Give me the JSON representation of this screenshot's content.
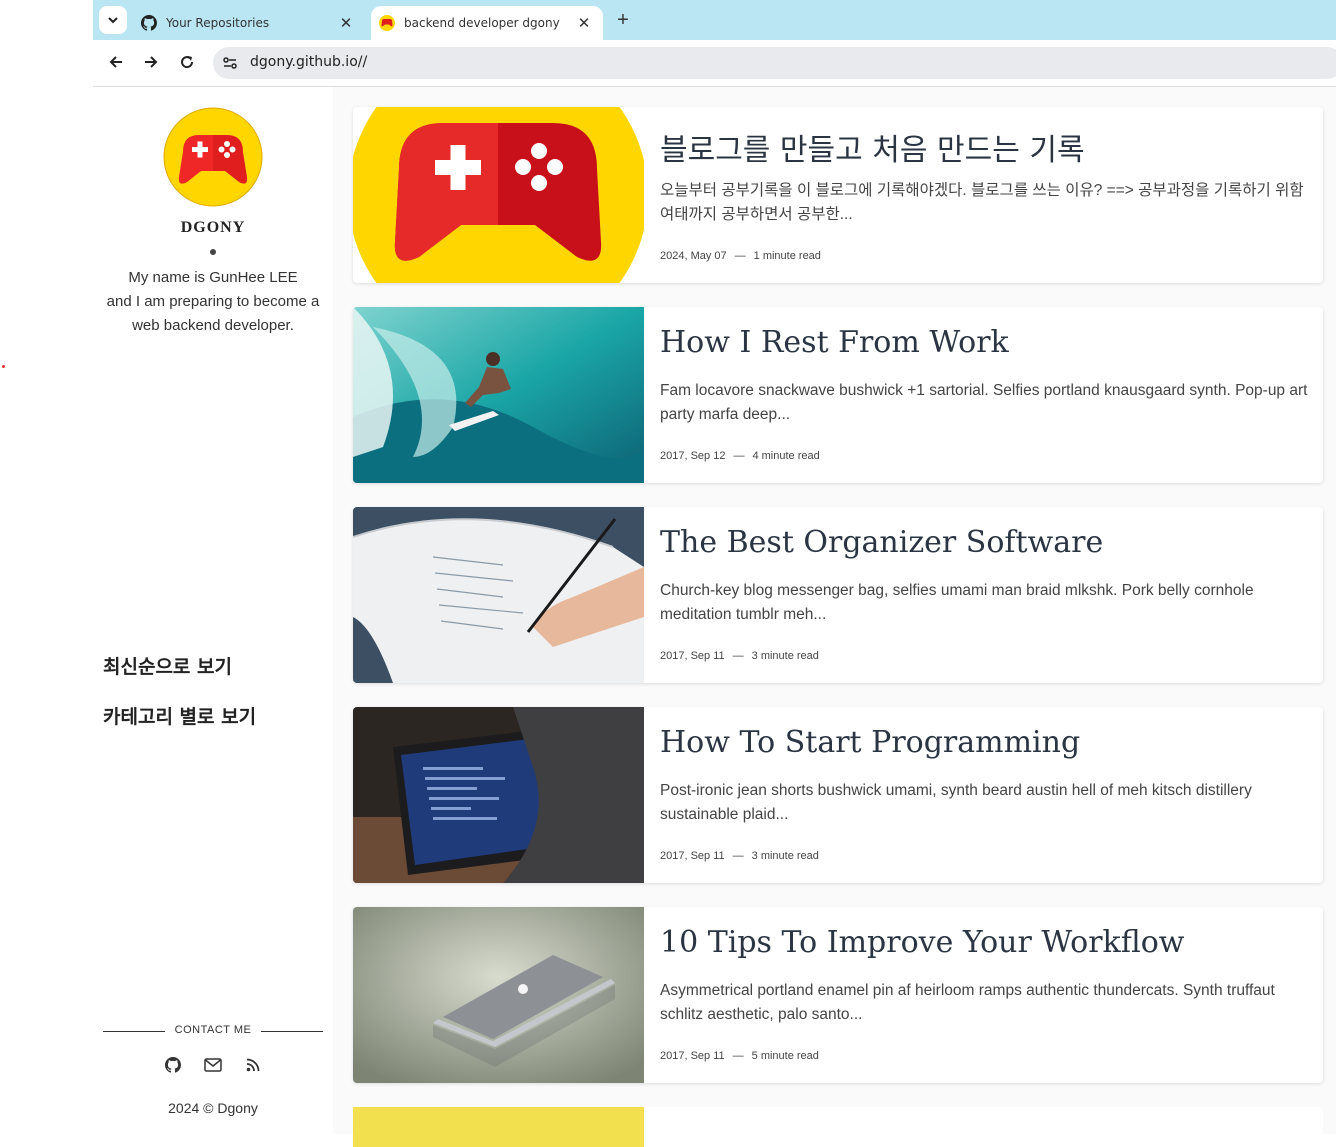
{
  "browser": {
    "tabs": [
      {
        "title": "Your Repositories",
        "icon": "github-icon",
        "active": false
      },
      {
        "title": "backend developer dgony",
        "icon": "gamepad-favicon",
        "active": true
      }
    ],
    "url": "dgony.github.io//"
  },
  "sidebar": {
    "author_name": "DGONY",
    "bio_lines": [
      "My name is GunHee LEE",
      "and I am preparing to become a",
      "web backend developer."
    ],
    "nav": [
      {
        "label": "최신순으로 보기"
      },
      {
        "label": "카테고리 별로 보기"
      }
    ],
    "contact_label": "CONTACT ME",
    "contact_icons": [
      "github-icon",
      "mail-icon",
      "rss-icon"
    ],
    "copyright": "2024 © Dgony"
  },
  "posts": [
    {
      "title": "블로그를 만들고 처음 만드는 기록",
      "excerpt": "오늘부터 공부기록을 이 블로그에 기록해야겠다. 블로그를 쓰는 이유? ==> 공부과정을 기록하기 위함 여태까지 공부하면서 공부한...",
      "date": "2024, May 07",
      "read_time": "1 minute read",
      "thumb": "gamepad-logo"
    },
    {
      "title": "How I Rest From Work",
      "excerpt": "Fam locavore snackwave bushwick +1 sartorial. Selfies portland knausgaard synth. Pop-up art party marfa deep...",
      "date": "2017, Sep 12",
      "read_time": "4 minute read",
      "thumb": "surfer-wave-photo"
    },
    {
      "title": "The Best Organizer Software",
      "excerpt": "Church-key blog messenger bag, selfies umami man braid mlkshk. Pork belly cornhole meditation tumblr meh...",
      "date": "2017, Sep 11",
      "read_time": "3 minute read",
      "thumb": "notebook-writing-photo"
    },
    {
      "title": "How To Start Programming",
      "excerpt": "Post-ironic jean shorts bushwick umami, synth beard austin hell of meh kitsch distillery sustainable plaid...",
      "date": "2017, Sep 11",
      "read_time": "3 minute read",
      "thumb": "laptop-code-photo"
    },
    {
      "title": "10 Tips To Improve Your Workflow",
      "excerpt": "Asymmetrical portland enamel pin af heirloom ramps authentic thundercats. Synth truffaut schlitz aesthetic, palo santo...",
      "date": "2017, Sep 11",
      "read_time": "5 minute read",
      "thumb": "macbook-photo"
    }
  ],
  "meta_separator": "—",
  "colors": {
    "tab_strip": "#b9e6f2",
    "accent_yellow": "#ffd600",
    "gamepad_red": "#e01e1e"
  }
}
